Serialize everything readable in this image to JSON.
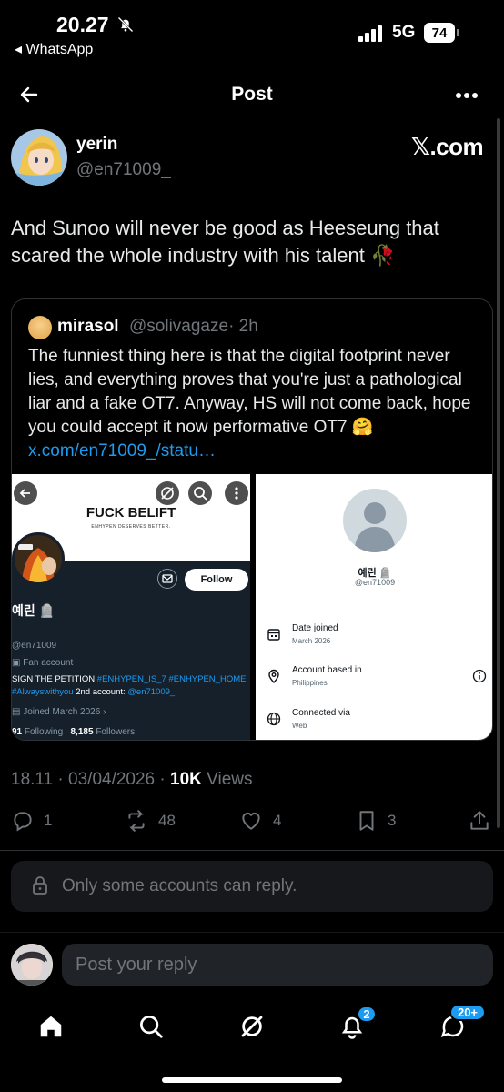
{
  "status_bar": {
    "time": "20.27",
    "back_app": "◂ WhatsApp",
    "network": "5G",
    "battery": "74"
  },
  "header": {
    "title": "Post"
  },
  "tweet": {
    "author_name": "yerin",
    "author_handle": "@en71009_",
    "source_label": "𝕏.com",
    "text": "And Sunoo will never be good as Heeseung that scared the whole industry with his talent 🥀",
    "time": "18.11",
    "date": "03/04/2026",
    "views_count": "10K",
    "views_label": "Views",
    "stats": {
      "replies": "1",
      "reposts": "48",
      "likes": "4",
      "bookmarks": "3"
    }
  },
  "quote": {
    "author_name": "mirasol",
    "author_handle": "@solivagaze",
    "age": "· 2h",
    "text": "The funniest thing here is that the digital footprint never lies, and everything proves that you're just a pathological liar and a fake OT7. Anyway, HS will not come back, hope you could accept it now performative OT7 🤗 ",
    "link": "x.com/en71009_/statu…",
    "profile_shot": {
      "banner_title": "FUCK BELIFT",
      "banner_sub": "ENHYPEN DESERVES BETTER.",
      "follow_label": "Follow",
      "name": "예린 🪦",
      "handle": "@en71009",
      "fan_label": "Fan account",
      "bio_prefix": "SIGN THE PETITION ",
      "bio_tags": "#ENHYPEN_IS_7 #ENHYPEN_HOME #Alwayswithyou",
      "bio_mid": " 2nd account: ",
      "bio_handle": "@en71009_",
      "joined": "Joined March 2026",
      "following_count": "91",
      "following_label": "Following",
      "followers_count": "8,185",
      "followers_label": "Followers"
    },
    "about_shot": {
      "name": "예린 🪦",
      "handle": "@en71009",
      "date_joined_label": "Date joined",
      "date_joined_value": "March 2026",
      "based_in_label": "Account based in",
      "based_in_value": "Philippines",
      "connected_label": "Connected via",
      "connected_value": "Web"
    }
  },
  "reply_restriction": "Only some accounts can reply.",
  "reply_placeholder": "Post your reply",
  "tabs": {
    "notifications_badge": "2",
    "messages_badge": "20+"
  },
  "colors": {
    "accent": "#1d9bf0",
    "background": "#000000",
    "muted": "#71767b"
  }
}
